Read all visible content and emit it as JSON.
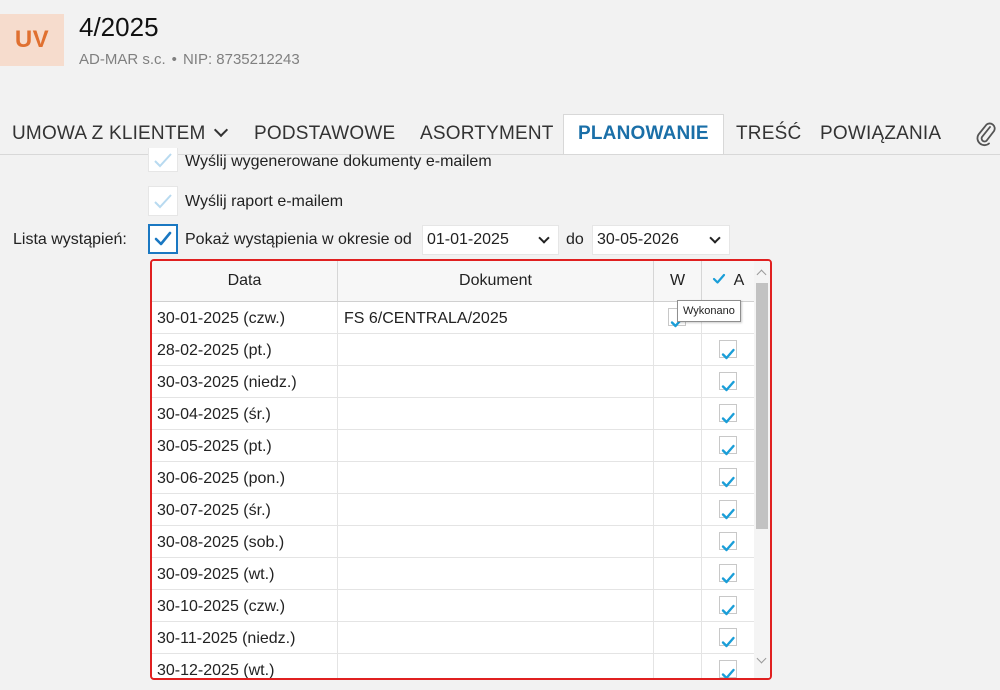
{
  "header": {
    "logo_text": "UV",
    "title": "4/2025",
    "company": "AD-MAR s.c.",
    "separator": "•",
    "nip": "NIP: 8735212243"
  },
  "tabs": [
    {
      "label": "UMOWA Z KLIENTEM",
      "active": false,
      "has_dropdown": true
    },
    {
      "label": "PODSTAWOWE",
      "active": false
    },
    {
      "label": "ASORTYMENT",
      "active": false
    },
    {
      "label": "PLANOWANIE",
      "active": true
    },
    {
      "label": "TREŚĆ",
      "active": false
    },
    {
      "label": "POWIĄZANIA",
      "active": false
    }
  ],
  "attachment_icon": "paperclip-icon",
  "options": {
    "send_docs": {
      "label": "Wyślij wygenerowane dokumenty e-mailem",
      "checked": true
    },
    "send_report": {
      "label": "Wyślij raport e-mailem",
      "checked": true
    }
  },
  "occurrences": {
    "label": "Lista wystąpień:",
    "show_label": "Pokaż wystąpienia w okresie od",
    "show_checked": true,
    "date_from": "01-01-2025",
    "to_label": "do",
    "date_to": "30-05-2026"
  },
  "grid": {
    "headers": {
      "date": "Data",
      "document": "Dokument",
      "w": "W",
      "a": "A"
    },
    "header_a_checked": true,
    "rows": [
      {
        "date": "30-01-2025 (czw.)",
        "document": "FS 6/CENTRALA/2025",
        "w": true,
        "a": false
      },
      {
        "date": "28-02-2025 (pt.)",
        "document": "",
        "w": false,
        "a": true
      },
      {
        "date": "30-03-2025 (niedz.)",
        "document": "",
        "w": false,
        "a": true
      },
      {
        "date": "30-04-2025 (śr.)",
        "document": "",
        "w": false,
        "a": true
      },
      {
        "date": "30-05-2025 (pt.)",
        "document": "",
        "w": false,
        "a": true
      },
      {
        "date": "30-06-2025 (pon.)",
        "document": "",
        "w": false,
        "a": true
      },
      {
        "date": "30-07-2025 (śr.)",
        "document": "",
        "w": false,
        "a": true
      },
      {
        "date": "30-08-2025 (sob.)",
        "document": "",
        "w": false,
        "a": true
      },
      {
        "date": "30-09-2025 (wt.)",
        "document": "",
        "w": false,
        "a": true
      },
      {
        "date": "30-10-2025 (czw.)",
        "document": "",
        "w": false,
        "a": true
      },
      {
        "date": "30-11-2025 (niedz.)",
        "document": "",
        "w": false,
        "a": true
      },
      {
        "date": "30-12-2025 (wt.)",
        "document": "",
        "w": false,
        "a": true
      }
    ]
  },
  "tooltip": "Wykonano",
  "colors": {
    "accent": "#1a6fa8",
    "check": "#1a9ed8",
    "highlight_border": "#e02020",
    "logo": "#e07030"
  }
}
